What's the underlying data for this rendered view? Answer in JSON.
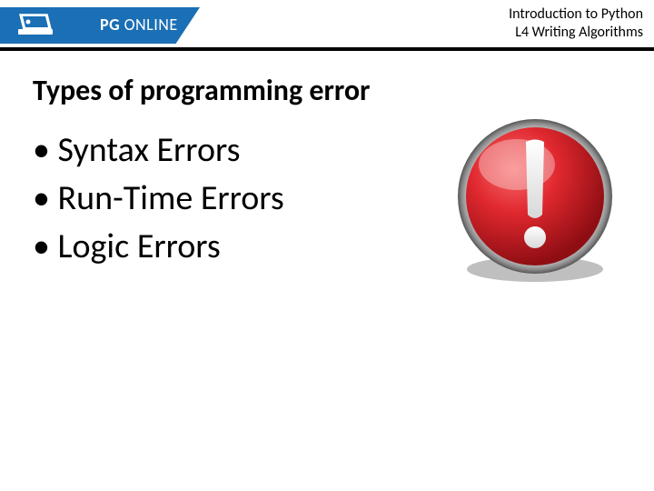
{
  "header": {
    "brand_pg": "PG",
    "brand_online": " ONLINE",
    "course_line1": "Introduction to Python",
    "course_line2": "L4 Writing Algorithms"
  },
  "slide": {
    "title": "Types of programming error",
    "bullets": [
      "Syntax Errors",
      "Run-Time Errors",
      "Logic Errors"
    ]
  },
  "colors": {
    "blue": "#1a6fb5",
    "red": "#c41f26"
  },
  "icons": {
    "logo": "laptop-icon",
    "alert": "exclamation-icon"
  }
}
